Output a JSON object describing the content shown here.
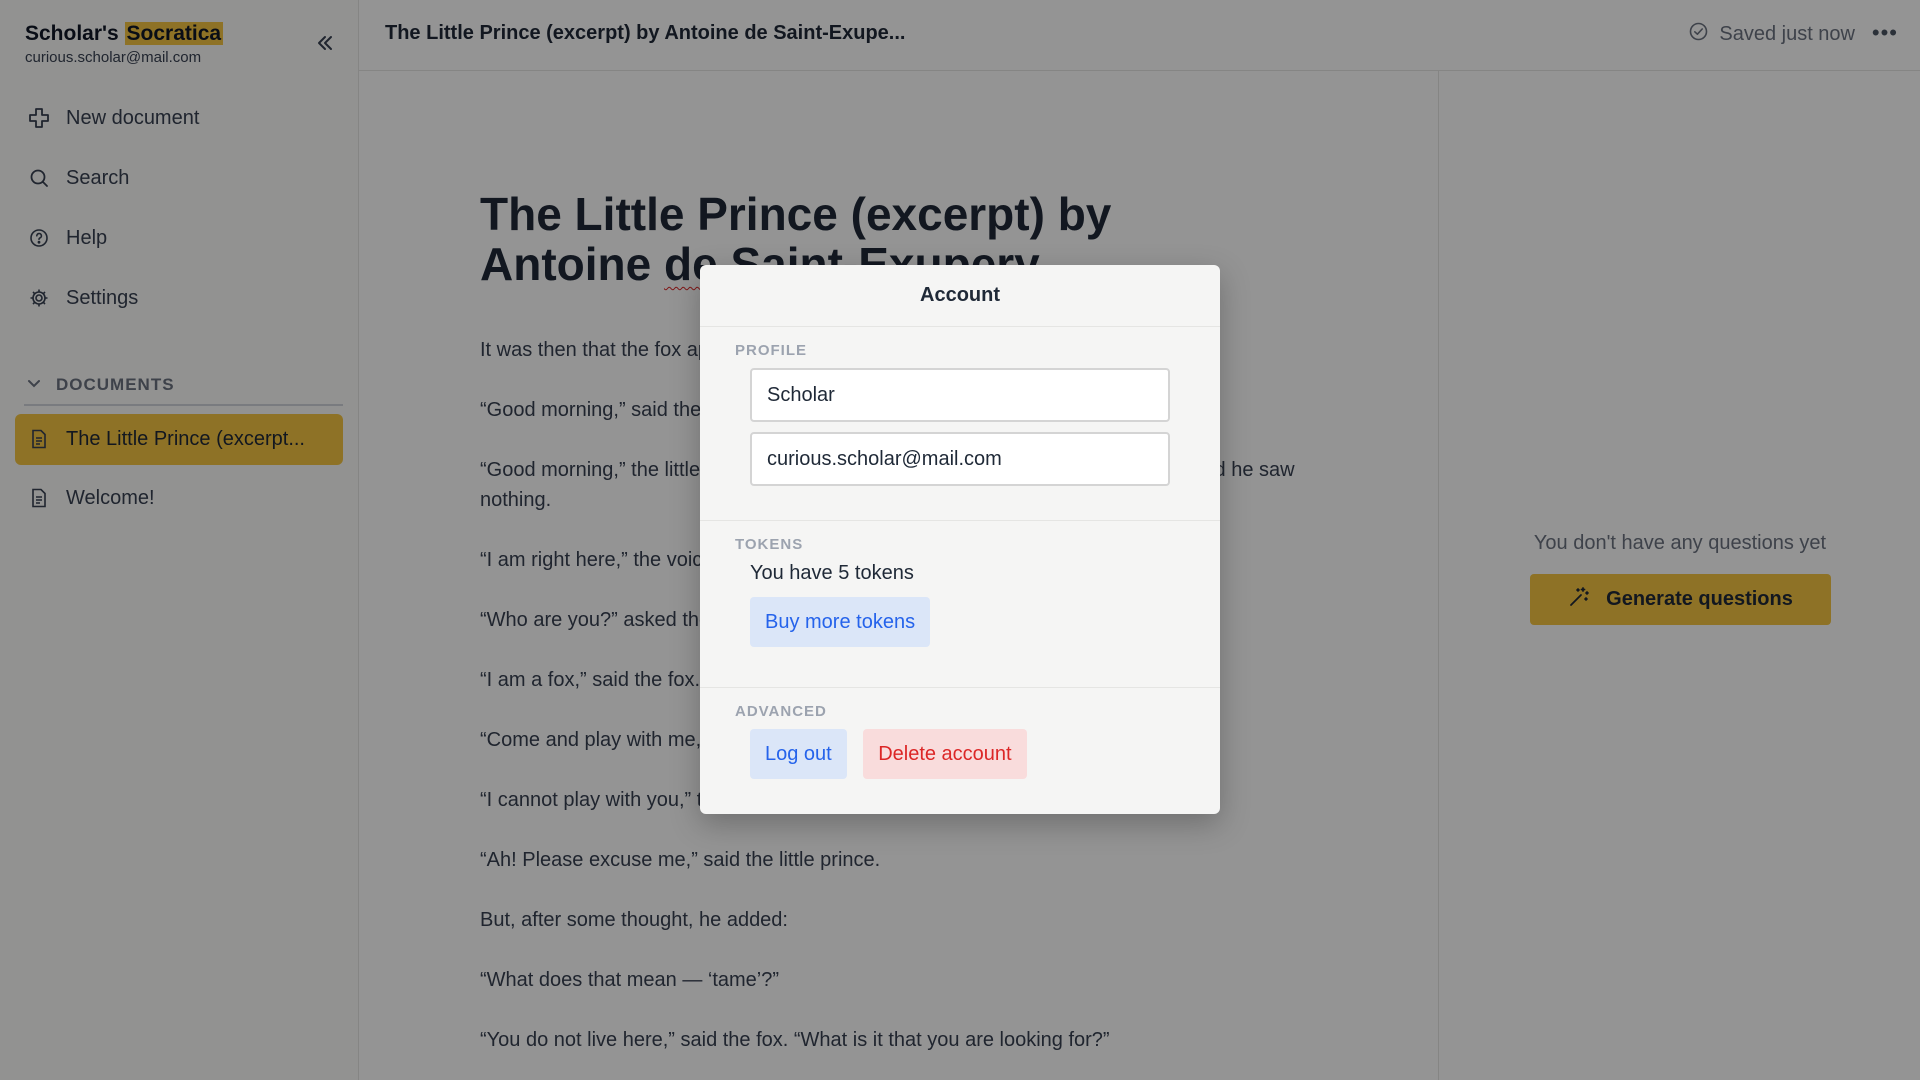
{
  "brand": {
    "name_prefix": "Scholar's ",
    "name_highlight": "Socratica",
    "email": "curious.scholar@mail.com"
  },
  "sidebar": {
    "collapse_icon": "chevrons-left-icon",
    "nav": [
      {
        "label": "New document",
        "icon": "plus-icon"
      },
      {
        "label": "Search",
        "icon": "search-icon"
      },
      {
        "label": "Help",
        "icon": "help-circle-icon"
      },
      {
        "label": "Settings",
        "icon": "gear-icon"
      }
    ],
    "documents_header": "DOCUMENTS",
    "documents": [
      {
        "label": "The Little Prince (excerpt...",
        "active": true
      },
      {
        "label": "Welcome!",
        "active": false
      }
    ]
  },
  "topbar": {
    "doc_title": "The Little Prince (excerpt) by Antoine de Saint-Exupe...",
    "saved_status": "Saved just now",
    "more_label": "•••"
  },
  "editor": {
    "title_part1": "The Little Prince (excerpt) by Antoine ",
    "title_misspelled": "de",
    "title_part2": " Saint-Exupery",
    "paragraphs": [
      "It was then that the fox appeared.",
      "“Good morning,” said the fox.",
      "“Good morning,” the little prince responded politely, although when he turned around he saw nothing.",
      "“I am right here,” the voice said, “under the apple tree.”",
      "“Who are you?” asked the little prince, and added, “You are very pretty to look at.”",
      "“I am a fox,” said the fox.",
      "“Come and play with me,” proposed the little prince.",
      "“I cannot play with you,” the fox said. “I am not tamed.”",
      "“Ah! Please excuse me,” said the little prince.",
      "But, after some thought, he added:",
      "“What does that mean — ‘tame’?”",
      "“You do not live here,” said the fox. “What is it that you are looking for?”"
    ]
  },
  "right_panel": {
    "empty_text": "You don't have any questions yet",
    "generate_label": "Generate questions",
    "generate_icon": "magic-wand-icon"
  },
  "modal": {
    "title": "Account",
    "profile_label": "PROFILE",
    "name_value": "Scholar",
    "email_value": "curious.scholar@mail.com",
    "tokens_label": "TOKENS",
    "tokens_text": "You have 5 tokens",
    "buy_label": "Buy more tokens",
    "advanced_label": "ADVANCED",
    "logout_label": "Log out",
    "delete_label": "Delete account"
  },
  "colors": {
    "accent": "#f5c542",
    "link_blue": "#2563eb",
    "danger_red": "#dc2626",
    "overlay": "rgba(0,0,0,0.42)"
  }
}
